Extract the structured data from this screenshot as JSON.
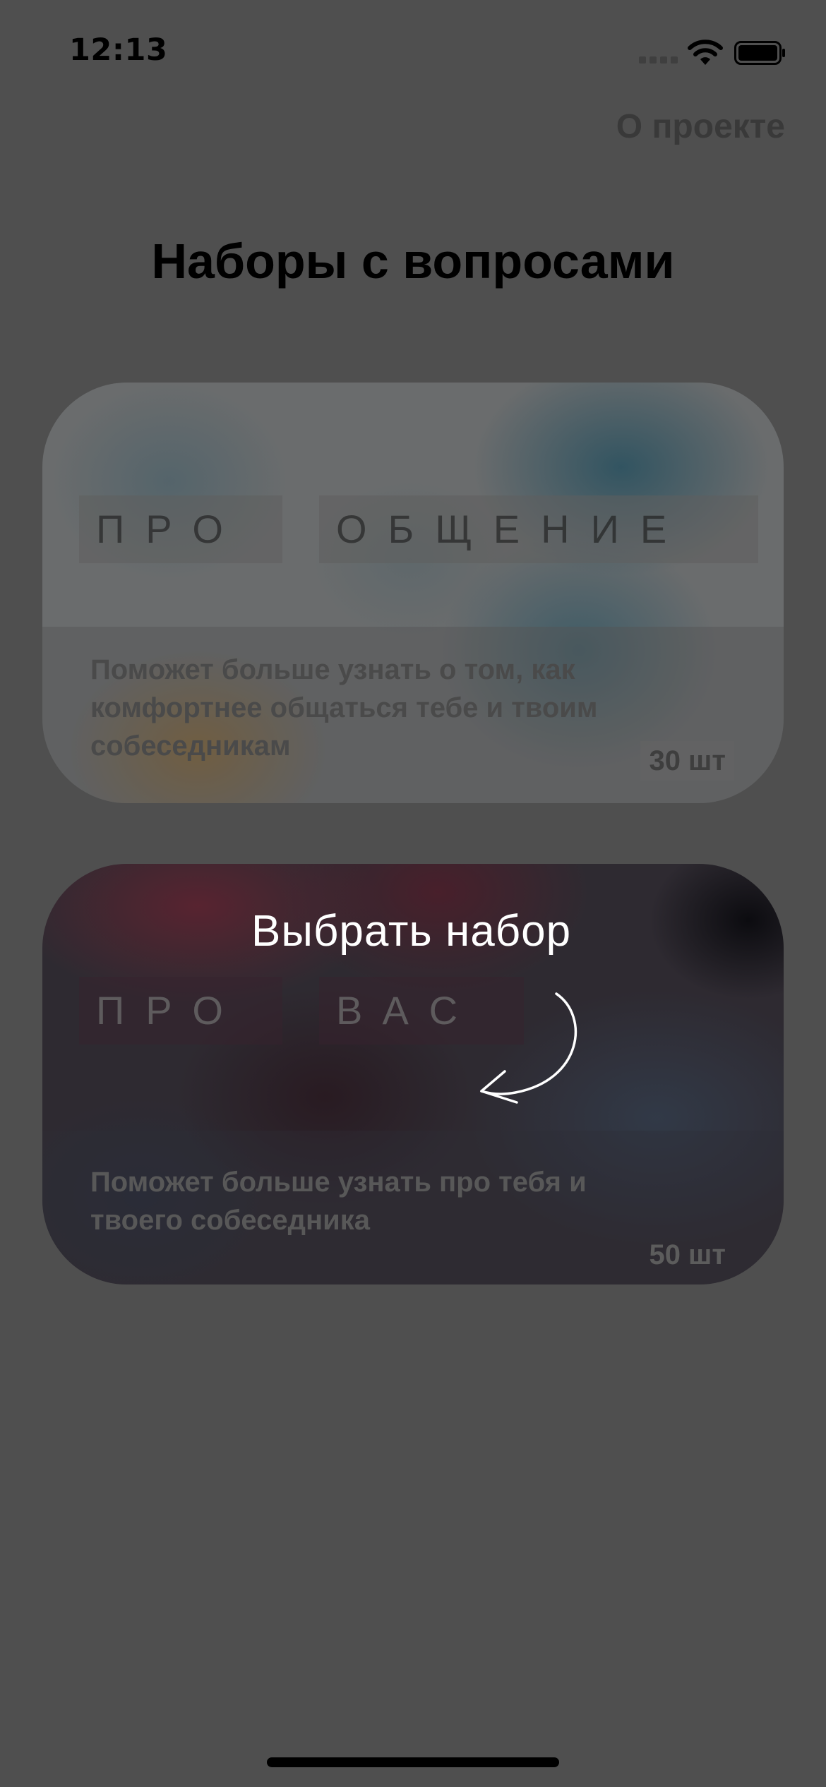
{
  "status_bar": {
    "time": "12:13"
  },
  "header": {
    "about_label": "О проекте",
    "title": "Наборы с вопросами"
  },
  "cards": [
    {
      "tag_word_1": "ПРО",
      "tag_word_2": "ОБЩЕНИЕ",
      "description": "Поможет больше узнать о том, как комфортнее общаться тебе и твоим собеседникам",
      "count": "30 шт"
    },
    {
      "tag_word_1": "ПРО",
      "tag_word_2": "ВАС",
      "description": "Поможет больше узнать про тебя и твоего собеседника",
      "count": "50 шт"
    }
  ],
  "hint": {
    "label": "Выбрать набор"
  },
  "colors": {
    "overlay": "#4f4f4f",
    "title": "#000000",
    "hint_text": "#ffffff"
  },
  "icons": {
    "signal": "cellular-signal-icon",
    "wifi": "wifi-icon",
    "battery": "battery-icon",
    "hint_arrow": "curved-arrow-icon"
  }
}
